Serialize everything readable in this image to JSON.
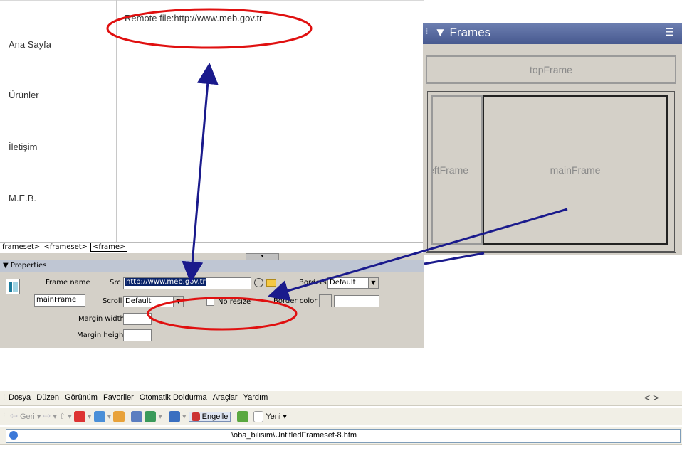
{
  "design_view": {
    "remote_file": "Remote file:http://www.meb.gov.tr",
    "nav": [
      "Ana Sayfa",
      "Ürünler",
      "İletişim",
      "M.E.B."
    ]
  },
  "tag_selector": {
    "tags": [
      "frameset>",
      "<frameset>",
      "<frame>"
    ]
  },
  "properties": {
    "title": "▼ Properties",
    "frame_name_label": "Frame name",
    "frame_name": "mainFrame",
    "src_label": "Src",
    "src_value": "http://www.meb.gov.tr",
    "scroll_label": "Scroll",
    "scroll_value": "Default",
    "no_resize_label": "No resize",
    "borders_label": "Borders",
    "borders_value": "Default",
    "border_color_label": "Border color",
    "margin_width_label": "Margin width",
    "margin_height_label": "Margin height"
  },
  "frames_panel": {
    "title": "▼ Frames",
    "top_frame": "topFrame",
    "left_frame": "eftFrame",
    "main_frame": "mainFrame"
  },
  "browser": {
    "menu": [
      "Dosya",
      "Düzen",
      "Görünüm",
      "Favoriler",
      "Otomatik Doldurma",
      "Araçlar",
      "Yardım"
    ],
    "back_label": "Geri",
    "block_label": "Engelle",
    "new_label": "Yeni",
    "address": "\\oba_bilisim\\UntitledFrameset-8.htm",
    "nav_arrows": "< >"
  },
  "colors": {
    "annotation_red": "#e01010",
    "arrow_blue": "#1a1a8c",
    "panel_gray": "#d4d0c8",
    "panel_header_blue": "#47598f"
  }
}
